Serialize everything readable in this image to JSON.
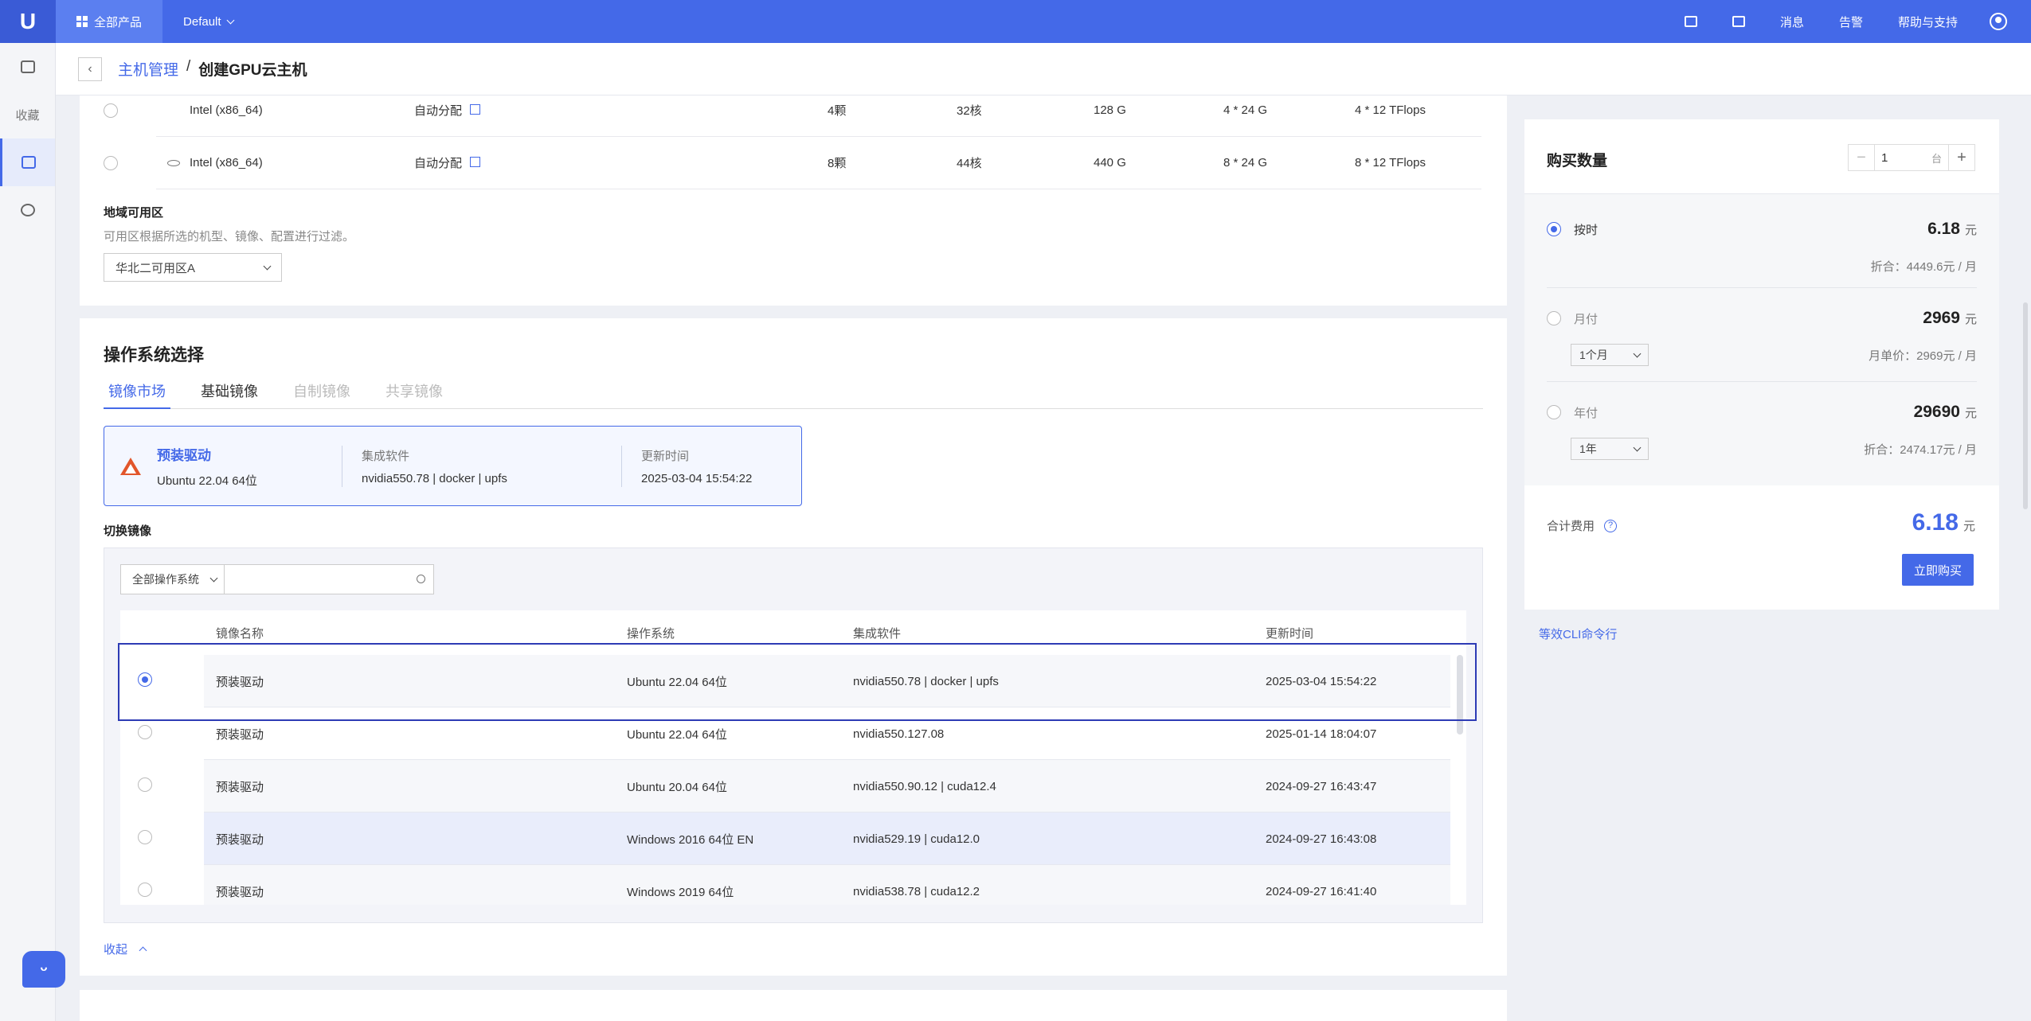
{
  "topbar": {
    "logo": "U",
    "all_products": "全部产品",
    "project": "Default",
    "messages": "消息",
    "alerts": "告警",
    "help": "帮助与支持"
  },
  "leftnav": {
    "favorites": "收藏"
  },
  "breadcrumb": {
    "parent": "主机管理",
    "sep": "/",
    "current": "创建GPU云主机"
  },
  "spec_rows": [
    {
      "cpu": "Intel (x86_64)",
      "alloc": "自动分配",
      "gpus": "4颗",
      "cores": "32核",
      "mem": "128 G",
      "gmem": "4 * 24 G",
      "flops": "4 * 12 TFlops"
    },
    {
      "cpu": "Intel (x86_64)",
      "alloc": "自动分配",
      "gpus": "8颗",
      "cores": "44核",
      "mem": "440 G",
      "gmem": "8 * 24 G",
      "flops": "8 * 12 TFlops"
    }
  ],
  "zone": {
    "label": "地域可用区",
    "hint": "可用区根据所选的机型、镜像、配置进行过滤。",
    "value": "华北二可用区A"
  },
  "os": {
    "title": "操作系统选择",
    "tabs": [
      "镜像市场",
      "基础镜像",
      "自制镜像",
      "共享镜像"
    ],
    "selected": {
      "name": "预装驱动",
      "os": "Ubuntu 22.04 64位",
      "software_label": "集成软件",
      "software": "nvidia550.78 | docker | upfs",
      "time_label": "更新时间",
      "time": "2025-03-04 15:54:22"
    },
    "switch_label": "切换镜像",
    "filter": "全部操作系统",
    "columns": [
      "镜像名称",
      "操作系统",
      "集成软件",
      "更新时间"
    ],
    "rows": [
      {
        "name": "预装驱动",
        "os": "Ubuntu 22.04 64位",
        "software": "nvidia550.78 | docker | upfs",
        "time": "2025-03-04 15:54:22",
        "selected": true
      },
      {
        "name": "预装驱动",
        "os": "Ubuntu 22.04 64位",
        "software": "nvidia550.127.08",
        "time": "2025-01-14 18:04:07",
        "selected": false
      },
      {
        "name": "预装驱动",
        "os": "Ubuntu 20.04 64位",
        "software": "nvidia550.90.12 | cuda12.4",
        "time": "2024-09-27 16:43:47",
        "selected": false
      },
      {
        "name": "预装驱动",
        "os": "Windows 2016 64位 EN",
        "software": "nvidia529.19 | cuda12.0",
        "time": "2024-09-27 16:43:08",
        "selected": false
      },
      {
        "name": "预装驱动",
        "os": "Windows 2019 64位",
        "software": "nvidia538.78 | cuda12.2",
        "time": "2024-09-27 16:41:40",
        "selected": false
      }
    ],
    "collapse": "收起"
  },
  "purchase": {
    "title": "购买数量",
    "qty": "1",
    "qty_unit": "台",
    "hourly": {
      "label": "按时",
      "price": "6.18",
      "unit": "元",
      "note": "折合：4449.6元 / 月"
    },
    "monthly": {
      "label": "月付",
      "price": "2969",
      "unit": "元",
      "period": "1个月",
      "note": "月单价：2969元 / 月"
    },
    "yearly": {
      "label": "年付",
      "price": "29690",
      "unit": "元",
      "period": "1年",
      "note": "折合：2474.17元 / 月"
    },
    "total_label": "合计费用",
    "total": "6.18",
    "total_unit": "元",
    "buy": "立即购买",
    "cli": "等效CLI命令行"
  },
  "colors": {
    "primary": "#4469e8",
    "outline": "#2d3bb5"
  }
}
